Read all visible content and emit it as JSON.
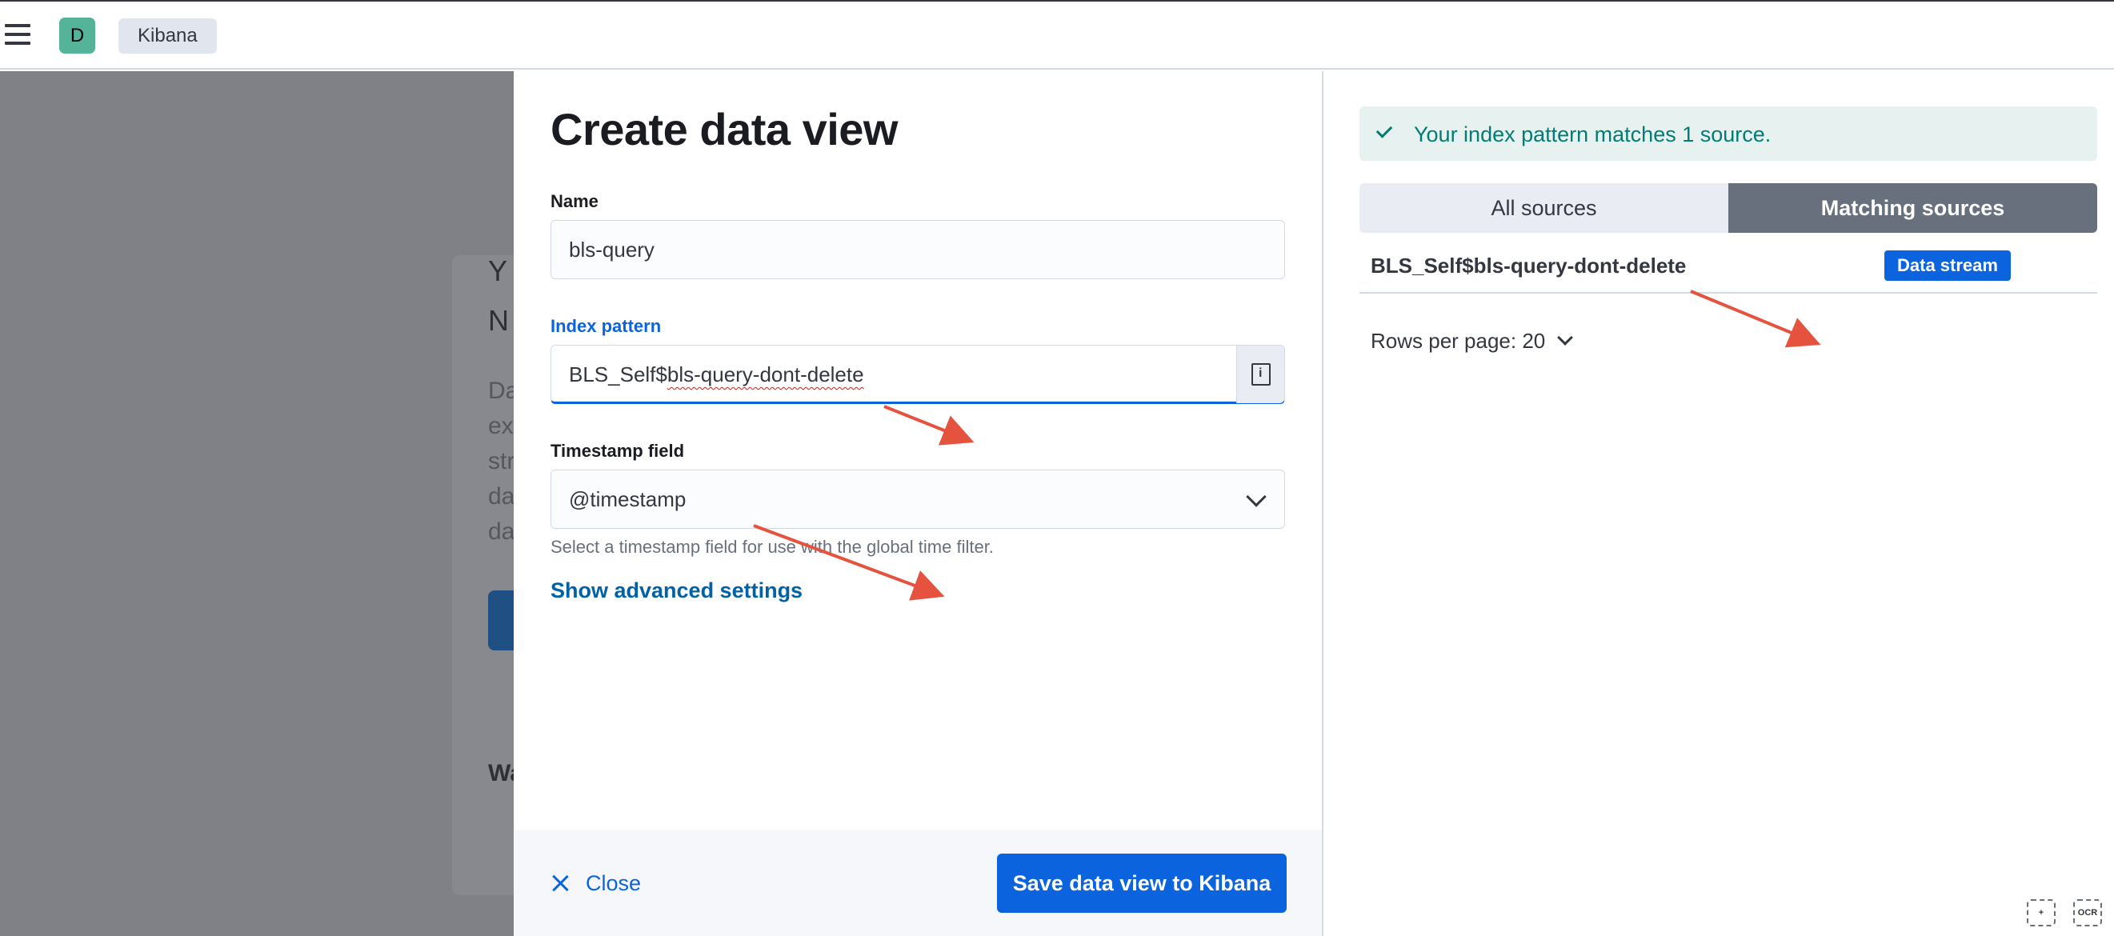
{
  "topbar": {
    "avatar_initial": "D",
    "breadcrumb": "Kibana"
  },
  "background": {
    "heading_line1": "Y",
    "heading_line2": "N",
    "text_lines": [
      "Da",
      "ex",
      "str",
      "da",
      "da"
    ],
    "footer_text": "Wa"
  },
  "flyout": {
    "title": "Create data view",
    "name_label": "Name",
    "name_value": "bls-query",
    "index_pattern_label": "Index pattern",
    "index_pattern_value_prefix": "BLS_Self$",
    "index_pattern_value_rest": "bls-query-dont-delete",
    "timestamp_label": "Timestamp field",
    "timestamp_value": "@timestamp",
    "timestamp_help": "Select a timestamp field for use with the global time filter.",
    "advanced_link": "Show advanced settings",
    "close_label": "Close",
    "save_label": "Save data view to Kibana"
  },
  "sources": {
    "callout": "Your index pattern matches 1 source.",
    "tabs": [
      {
        "label": "All sources",
        "selected": false
      },
      {
        "label": "Matching sources",
        "selected": true
      }
    ],
    "rows": [
      {
        "name": "BLS_Self$bls-query-dont-delete",
        "type": "Data stream"
      }
    ],
    "rows_per_page": "Rows per page: 20"
  },
  "corner_icons": [
    "zoom-icon",
    "ocr-icon"
  ],
  "corner_icon_labels": [
    "+",
    "OCR"
  ],
  "colors": {
    "primary": "#0b64dd",
    "success": "#017d73",
    "annotation_arrow": "#e5533f"
  }
}
